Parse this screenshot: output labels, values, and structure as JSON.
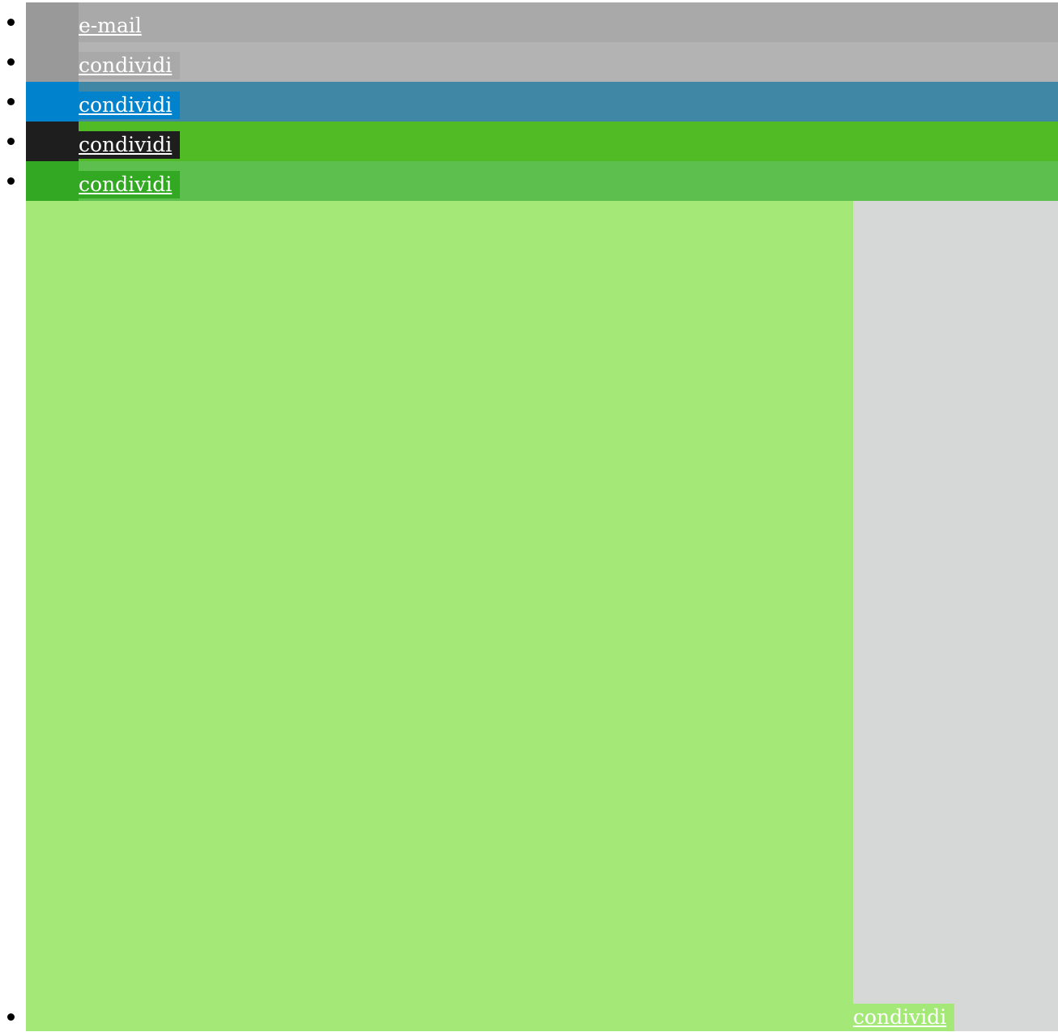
{
  "share_items": [
    {
      "label": "e-mail",
      "icon_name": "email-icon",
      "icon_color": "#999999",
      "bar_color": "#a9a9a9",
      "link_bg": "#a9a9a9"
    },
    {
      "label": "condividi",
      "icon_name": "share-icon",
      "icon_color": "#999999",
      "bar_color": "#b3b3b3",
      "link_bg": "#a9a9a9"
    },
    {
      "label": "condividi",
      "icon_name": "share-icon",
      "icon_color": "#0082cc",
      "bar_color": "#4087a6",
      "link_bg": "#0082cc"
    },
    {
      "label": "condividi",
      "icon_name": "share-icon",
      "icon_color": "#1e1e1e",
      "bar_color": "#50bb24",
      "link_bg": "#1e1e1e"
    },
    {
      "label": "condividi",
      "icon_name": "share-icon",
      "icon_color": "#33a822",
      "bar_color": "#5dbf4d",
      "link_bg": "#33a822"
    }
  ],
  "last_item": {
    "label": "condividi",
    "icon_name": "share-icon",
    "panel_color": "#a4e977",
    "side_color": "#d6d8d7",
    "link_bg": "#a4e977"
  }
}
